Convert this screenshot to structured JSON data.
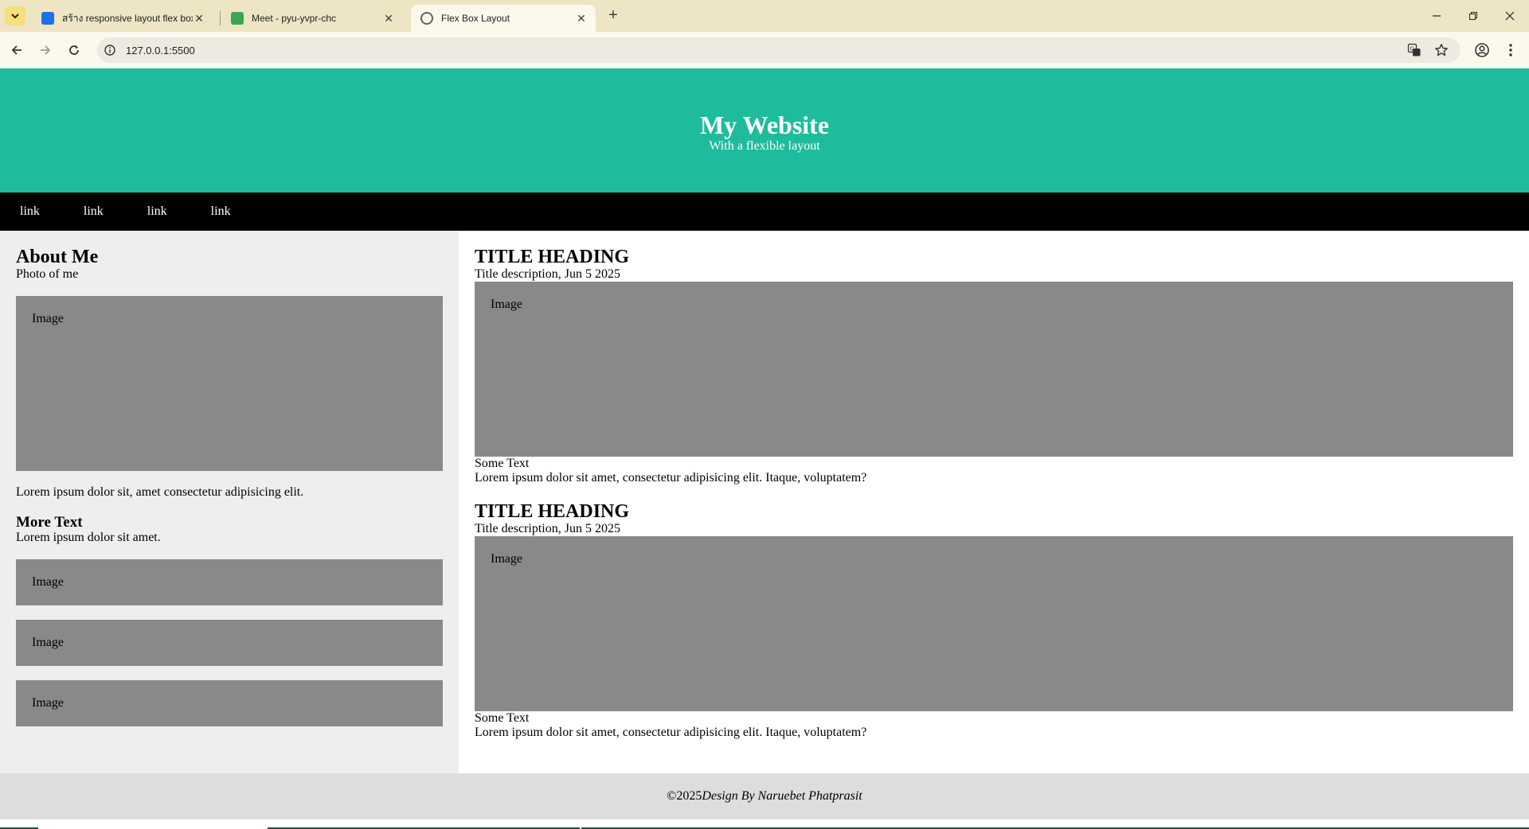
{
  "browser": {
    "tabs": [
      {
        "title": "สร้าง responsive layout flex box",
        "active": false,
        "favicon_color": "#1a73e8"
      },
      {
        "title": "Meet - pyu-yvpr-chc",
        "active": false,
        "favicon_color": "#34a853"
      },
      {
        "title": "Flex Box Layout",
        "active": true,
        "favicon_color": "#5f6368"
      }
    ],
    "url": "127.0.0.1:5500",
    "tabbar_color": "#ede5c4",
    "toolbar_color": "#fbf8ec"
  },
  "site": {
    "header": {
      "title": "My Website",
      "subtitle": "With a flexible layout",
      "bg_color": "#1ebc9c"
    },
    "nav": {
      "links": [
        "link",
        "link",
        "link",
        "link"
      ]
    },
    "sidebar": {
      "about_heading": "About Me",
      "photo_caption": "Photo of me",
      "image_label": "Image",
      "about_text": "Lorem ipsum dolor sit, amet consectetur adipisicing elit.",
      "more_heading": "More Text",
      "more_text": "Lorem ipsum dolor sit amet.",
      "small_images": [
        "Image",
        "Image",
        "Image"
      ]
    },
    "posts": [
      {
        "heading": "TITLE HEADING",
        "description": "Title description, Jun 5 2025",
        "image_label": "Image",
        "some_text": "Some Text",
        "body": "Lorem ipsum dolor sit amet, consectetur adipisicing elit. Itaque, voluptatem?"
      },
      {
        "heading": "TITLE HEADING",
        "description": "Title description, Jun 5 2025",
        "image_label": "Image",
        "some_text": "Some Text",
        "body": "Lorem ipsum dolor sit amet, consectetur adipisicing elit. Itaque, voluptatem?"
      }
    ],
    "footer": {
      "year_prefix": "©2025 ",
      "credit": "Design By Naruebet Phatprasit"
    }
  }
}
